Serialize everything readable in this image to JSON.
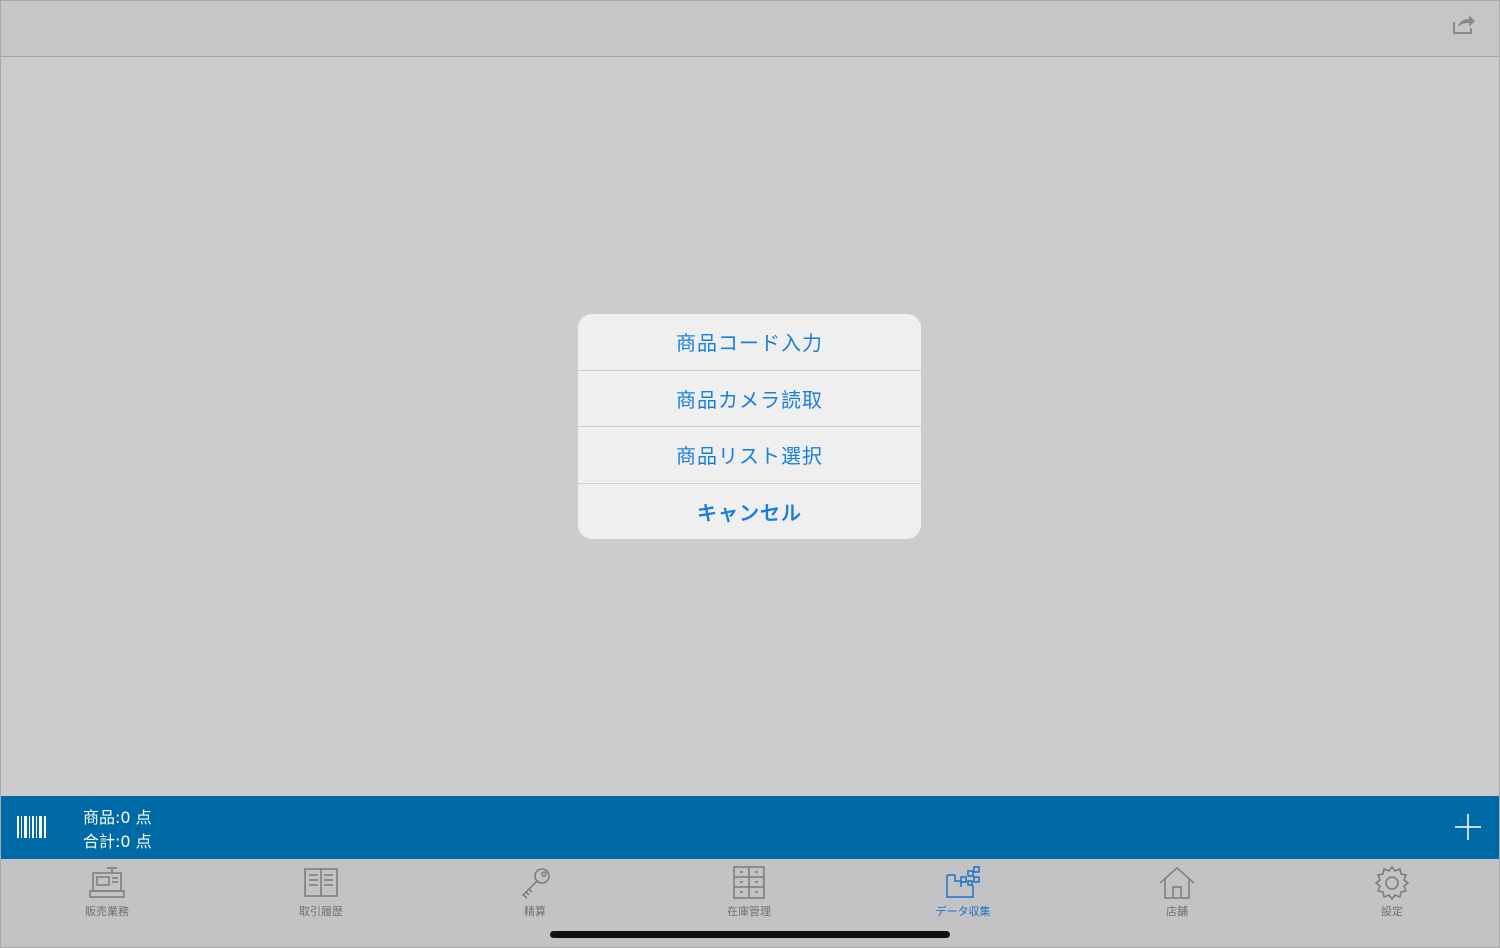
{
  "action_sheet": {
    "items": [
      {
        "label": "商品コード入力"
      },
      {
        "label": "商品カメラ読取"
      },
      {
        "label": "商品リスト選択"
      },
      {
        "label": "キャンセル"
      }
    ]
  },
  "status_bar": {
    "items_count": "商品:0 点",
    "total_count": "合計:0 点"
  },
  "tabs": [
    {
      "label": "販売業務",
      "icon": "register-icon"
    },
    {
      "label": "取引履歴",
      "icon": "book-icon"
    },
    {
      "label": "精算",
      "icon": "key-icon"
    },
    {
      "label": "在庫管理",
      "icon": "cabinet-icon"
    },
    {
      "label": "データ収集",
      "icon": "data-collect-icon",
      "active": true
    },
    {
      "label": "店舗",
      "icon": "house-icon"
    },
    {
      "label": "設定",
      "icon": "gear-icon"
    }
  ],
  "colors": {
    "accent": "#1a7fdc",
    "status_bar": "#006aa7",
    "tab_active": "#1a73c9",
    "tab_inactive": "#707070"
  }
}
